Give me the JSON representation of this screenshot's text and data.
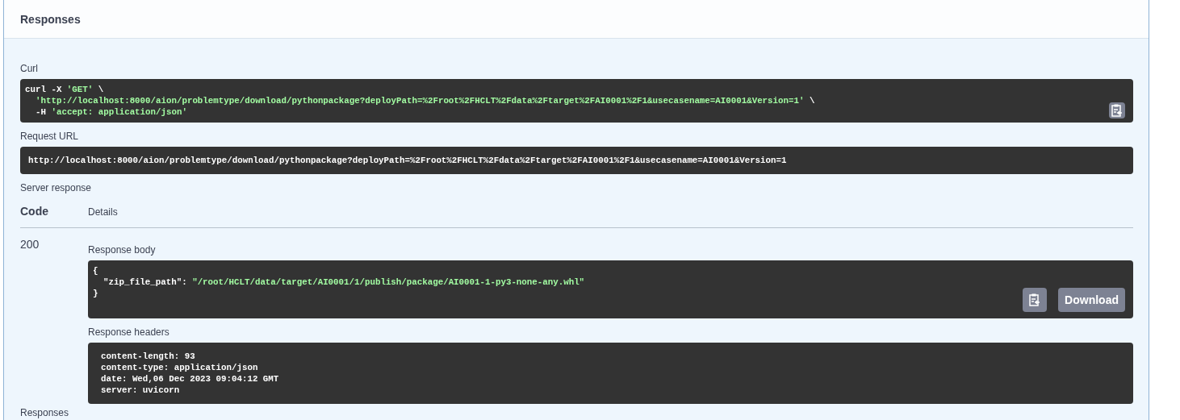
{
  "section_title": "Responses",
  "curl": {
    "label": "Curl",
    "lines": [
      [
        {
          "kind": "plain",
          "text": "curl -X "
        },
        {
          "kind": "string",
          "text": "'GET'"
        },
        {
          "kind": "plain",
          "text": " \\"
        }
      ],
      [
        {
          "kind": "string",
          "text": "'http://localhost:8000/aion/problemtype/download/pythonpackage?deployPath=%2Froot%2FHCLT%2Fdata%2Ftarget%2FAI0001%2F1&usecasename=AI0001&Version=1'"
        },
        {
          "kind": "plain",
          "text": " \\"
        }
      ],
      [
        {
          "kind": "plain",
          "text": "-H "
        },
        {
          "kind": "string",
          "text": "'accept: application/json'"
        }
      ]
    ]
  },
  "request_url": {
    "label": "Request URL",
    "value": "http://localhost:8000/aion/problemtype/download/pythonpackage?deployPath=%2Froot%2FHCLT%2Fdata%2Ftarget%2FAI0001%2F1&usecasename=AI0001&Version=1"
  },
  "server_response": {
    "label": "Server response",
    "columns": [
      "Code",
      "Details"
    ],
    "code": "200",
    "body_label": "Response body",
    "body_lines": [
      [
        {
          "kind": "plain",
          "text": "{"
        }
      ],
      [
        {
          "kind": "plain",
          "text": "\"zip_file_path\": "
        },
        {
          "kind": "string",
          "text": "\"/root/HCLT/data/target/AI0001/1/publish/package/AI0001-1-py3-none-any.whl\""
        }
      ],
      [
        {
          "kind": "plain",
          "text": "}"
        }
      ]
    ],
    "download_button": "Download",
    "headers_label": "Response headers",
    "headers": [
      "content-length: 93",
      "content-type: application/json",
      "date: Wed,06 Dec 2023 09:04:12 GMT",
      "server: uvicorn"
    ]
  },
  "next_heading": "Responses"
}
